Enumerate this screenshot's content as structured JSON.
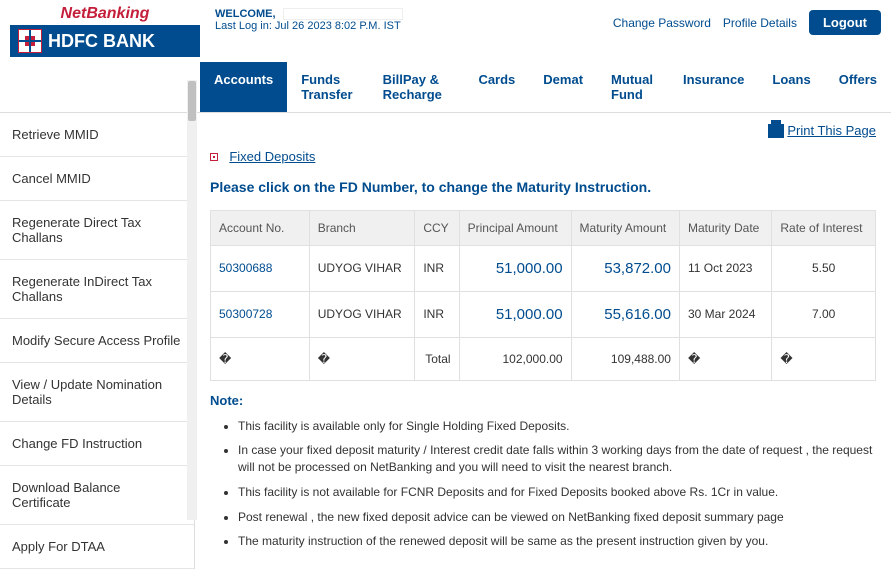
{
  "header": {
    "netbanking_label": "NetBanking",
    "bank_name": "HDFC BANK",
    "welcome_label": "WELCOME,",
    "last_login": "Last Log in: Jul 26 2023 8:02 P.M. IST",
    "change_password": "Change Password",
    "profile_details": "Profile Details",
    "logout": "Logout"
  },
  "nav": {
    "items": [
      "Accounts",
      "Funds Transfer",
      "BillPay & Recharge",
      "Cards",
      "Demat",
      "Mutual Fund",
      "Insurance",
      "Loans",
      "Offers"
    ],
    "active_index": 0
  },
  "sidebar": {
    "items": [
      "Retrieve MMID",
      "Cancel MMID",
      "Regenerate Direct Tax Challans",
      "Regenerate InDirect Tax Challans",
      "Modify Secure Access Profile",
      "View / Update Nomination Details",
      "Change FD Instruction",
      "Download Balance Certificate",
      "Apply For DTAA"
    ]
  },
  "content": {
    "print_label": "Print This Page",
    "breadcrumb": "Fixed Deposits",
    "title": "Please click on the FD Number, to change the Maturity Instruction.",
    "table": {
      "headers": {
        "account": "Account No.",
        "branch": "Branch",
        "ccy": "CCY",
        "principal": "Principal Amount",
        "maturity": "Maturity Amount",
        "date": "Maturity Date",
        "rate": "Rate of Interest"
      },
      "rows": [
        {
          "account": "50300688",
          "branch": "UDYOG VIHAR",
          "ccy": "INR",
          "principal": "51,000.00",
          "maturity": "53,872.00",
          "date": "11 Oct 2023",
          "rate": "5.50"
        },
        {
          "account": "50300728",
          "branch": "UDYOG VIHAR",
          "ccy": "INR",
          "principal": "51,000.00",
          "maturity": "55,616.00",
          "date": "30 Mar 2024",
          "rate": "7.00"
        }
      ],
      "total": {
        "blank": "�",
        "label": "Total",
        "principal": "102,000.00",
        "maturity": "109,488.00"
      }
    },
    "note_title": "Note:",
    "notes": [
      "This facility is available only for Single Holding Fixed Deposits.",
      "In case your fixed deposit maturity / Interest credit date falls within 3 working days from the date of request , the request will not be processed on NetBanking and you will need to visit the nearest branch.",
      "This facility is not available for FCNR Deposits and for Fixed Deposits booked above Rs. 1Cr in value.",
      "Post renewal , the new fixed deposit advice can be viewed on NetBanking fixed deposit summary page",
      "The maturity instruction of the renewed deposit will be same as the present instruction given by you."
    ]
  }
}
